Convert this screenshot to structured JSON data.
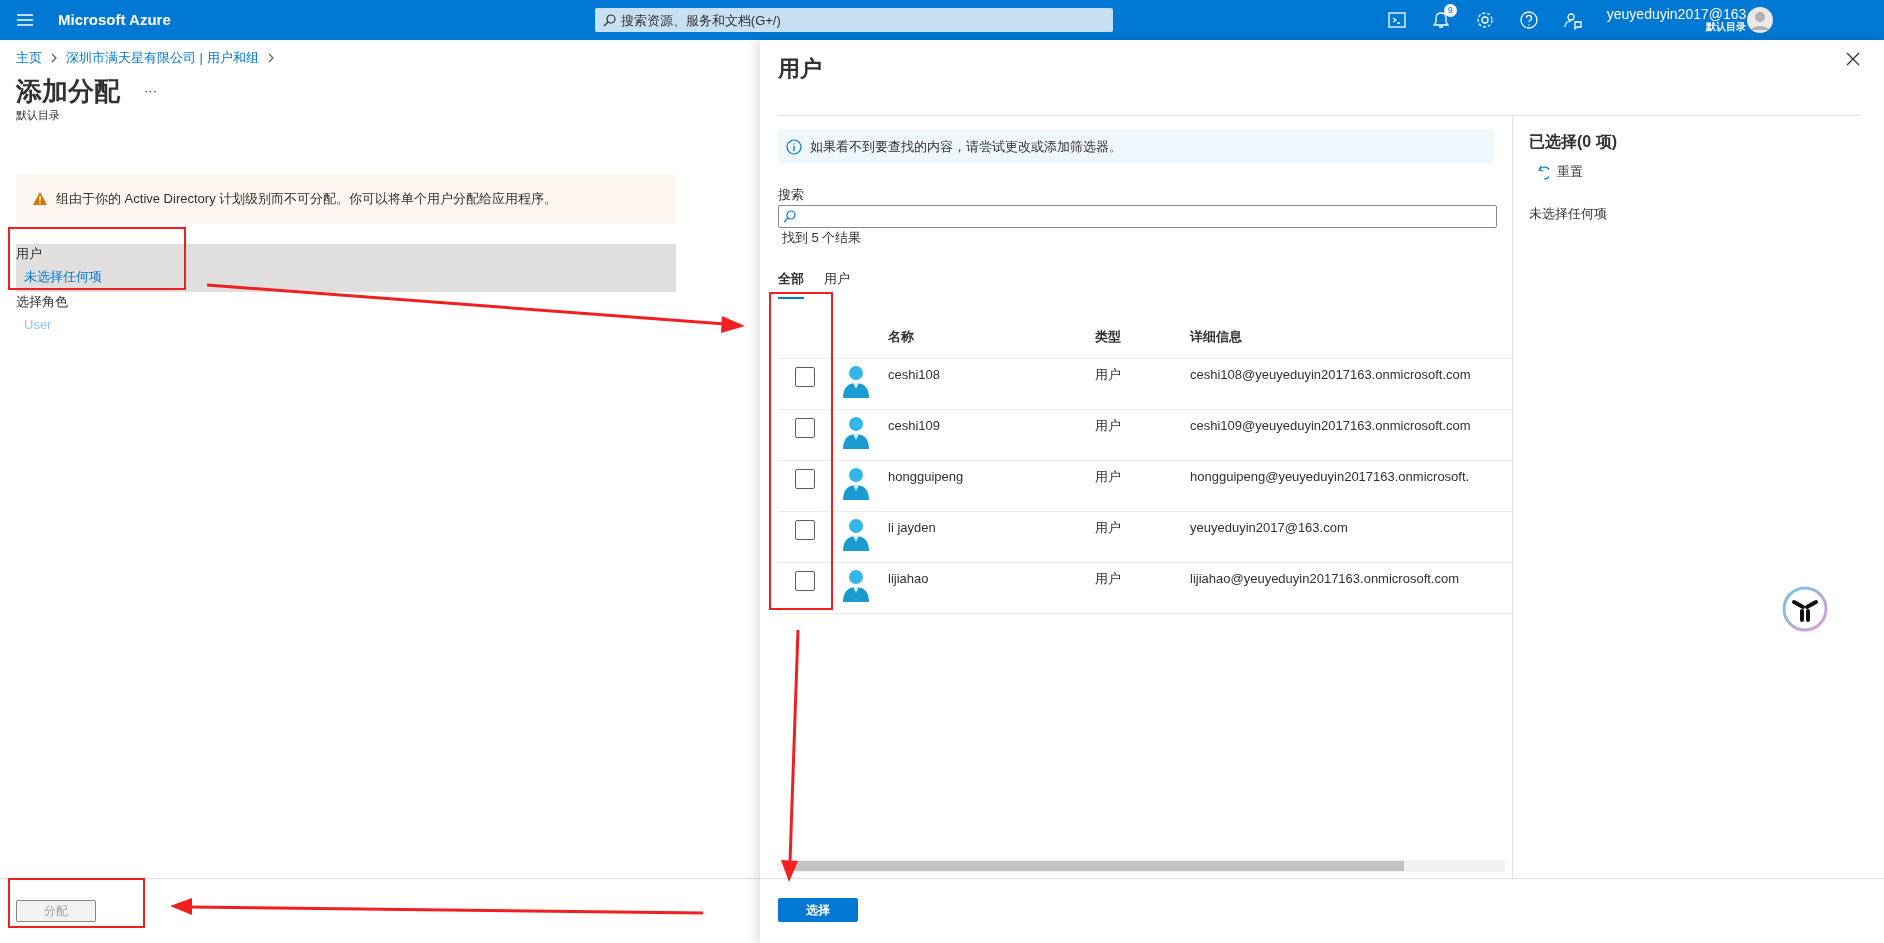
{
  "top_bar": {
    "brand": "Microsoft Azure",
    "search": {
      "placeholder": "搜索资源、服务和文档(G+/)"
    },
    "notification_count": "9",
    "account": {
      "name": "yeuyeduyin2017@163",
      "directory": "默认目录"
    }
  },
  "assign_page": {
    "breadcrumb": [
      "主页",
      "深圳市满天星有限公司 | 用户和组"
    ],
    "title": "添加分配",
    "more": "···",
    "subtitle": "默认目录",
    "warning": "组由于你的 Active Directory 计划级别而不可分配。你可以将单个用户分配给应用程序。",
    "fields": [
      {
        "label": "用户",
        "value": "未选择任何项",
        "selected": true
      },
      {
        "label": "选择角色",
        "value": "User",
        "selected": false
      }
    ],
    "assign_button": {
      "label": "分配",
      "disabled": true
    }
  },
  "users_blade": {
    "title": "用户",
    "info": "如果看不到要查找的内容，请尝试更改或添加筛选器。",
    "search_label": "搜索",
    "result_count": "找到 5 个结果",
    "tabs": [
      {
        "label": "全部",
        "selected": true
      },
      {
        "label": "用户",
        "selected": false
      }
    ],
    "table": {
      "columns": [
        "名称",
        "类型",
        "详细信息"
      ],
      "rows": [
        {
          "name": "ceshi108",
          "type": "用户",
          "details": "ceshi108@yeuyeduyin2017163.onmicrosoft.com",
          "checked": false
        },
        {
          "name": "ceshi109",
          "type": "用户",
          "details": "ceshi109@yeuyeduyin2017163.onmicrosoft.com",
          "checked": false
        },
        {
          "name": "hongguipeng",
          "type": "用户",
          "details": "hongguipeng@yeuyeduyin2017163.onmicrosoft.",
          "checked": false
        },
        {
          "name": "li jayden",
          "type": "用户",
          "details": "yeuyeduyin2017@163.com",
          "checked": false
        },
        {
          "name": "lijiahao",
          "type": "用户",
          "details": "lijiahao@yeuyeduyin2017163.onmicrosoft.com",
          "checked": false
        }
      ]
    },
    "selection": {
      "title": "已选择(0 项)",
      "reset": "重置",
      "empty": "未选择任何项"
    },
    "select_button": {
      "label": "选择",
      "disabled": false
    }
  }
}
